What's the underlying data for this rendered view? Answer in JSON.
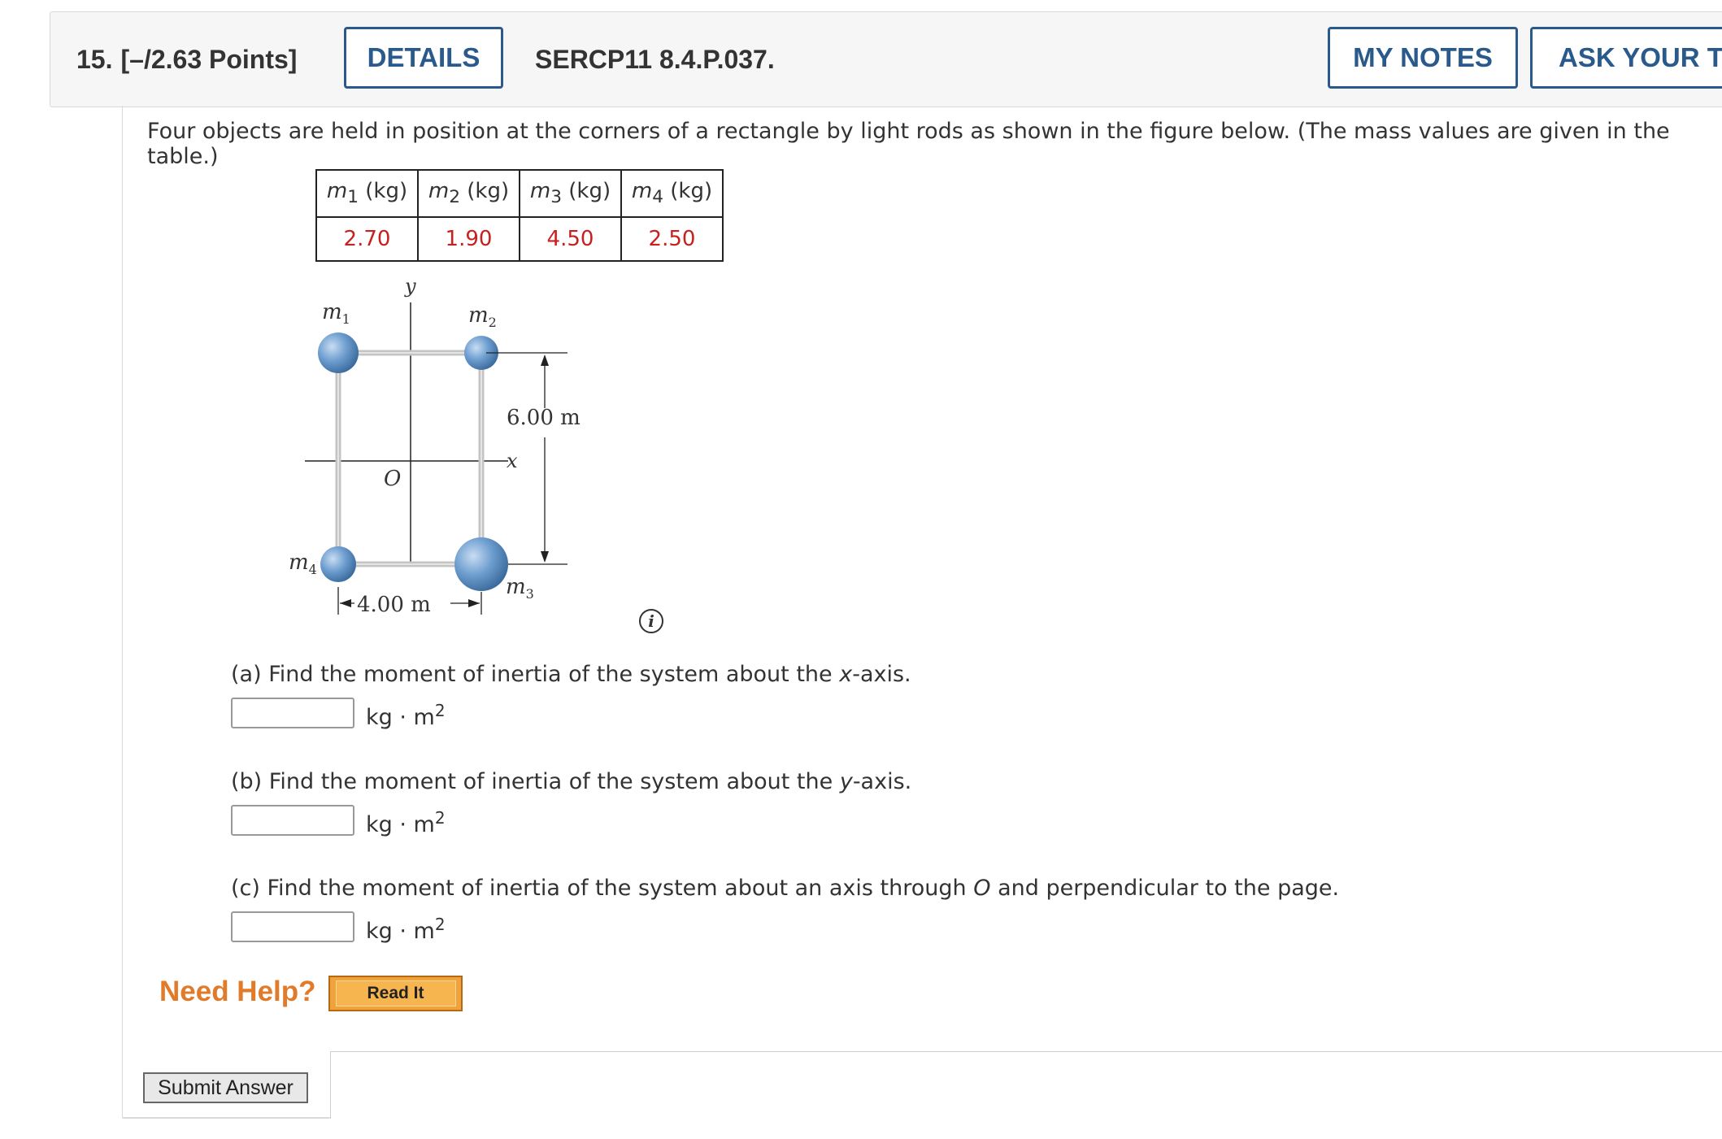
{
  "header": {
    "question_number": "15.",
    "points": "[–/2.63 Points]",
    "details_label": "DETAILS",
    "problem_code": "SERCP11 8.4.P.037.",
    "my_notes_label": "MY NOTES",
    "ask_teacher_label": "ASK YOUR TE"
  },
  "problem": {
    "intro": "Four objects are held in position at the corners of a rectangle by light rods as shown in the figure below. (The mass values are given in the table.)"
  },
  "mass_table": {
    "headers": [
      {
        "var": "m",
        "sub": "1",
        "unit": " (kg)"
      },
      {
        "var": "m",
        "sub": "2",
        "unit": " (kg)"
      },
      {
        "var": "m",
        "sub": "3",
        "unit": " (kg)"
      },
      {
        "var": "m",
        "sub": "4",
        "unit": " (kg)"
      }
    ],
    "values": [
      "2.70",
      "1.90",
      "4.50",
      "2.50"
    ]
  },
  "figure": {
    "y_axis": "y",
    "x_axis": "x",
    "origin": "O",
    "m1": "m",
    "m1_sub": "1",
    "m2": "m",
    "m2_sub": "2",
    "m3": "m",
    "m3_sub": "3",
    "m4": "m",
    "m4_sub": "4",
    "height_dim": "6.00 m",
    "width_dim": "4.00 m"
  },
  "parts": {
    "a": {
      "prefix": "(a) Find the moment of inertia of the system about the ",
      "axis": "x",
      "suffix": "-axis."
    },
    "b": {
      "prefix": "(b) Find the moment of inertia of the system about the ",
      "axis": "y",
      "suffix": "-axis."
    },
    "c": {
      "prefix": "(c) Find the moment of inertia of the system about an axis through ",
      "axis": "O",
      "suffix": " and perpendicular to the page."
    }
  },
  "units": {
    "text": "kg · m",
    "power": "2"
  },
  "help": {
    "need_help": "Need Help?",
    "read_it": "Read It"
  },
  "submit_label": "Submit Answer",
  "colors": {
    "accent": "#2a5a8c",
    "value_red": "#c8201e",
    "help_orange": "#e17b2a"
  }
}
